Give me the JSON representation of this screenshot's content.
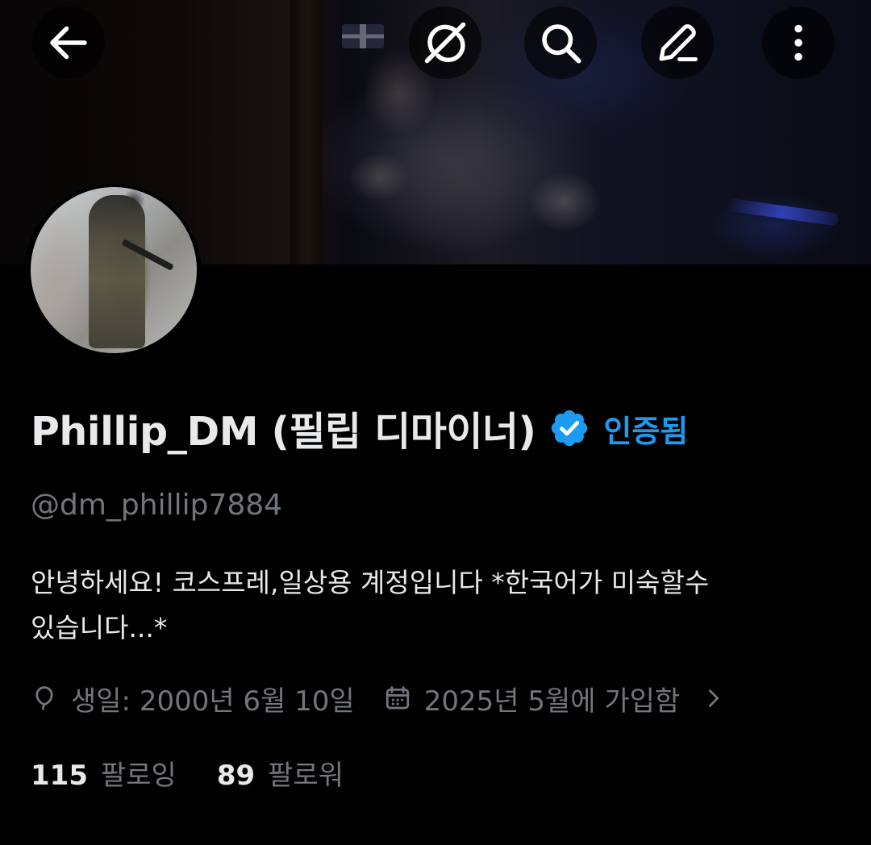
{
  "header": {
    "back_icon": "arrow-left-icon",
    "grok_icon": "grok-icon",
    "search_icon": "search-icon",
    "edit_icon": "edit-pencil-icon",
    "more_icon": "more-vertical-icon"
  },
  "profile": {
    "display_name": "Phillip_DM (필립 디마이너)",
    "verified_label": "인증됨",
    "handle": "@dm_phillip7884",
    "bio_line1": "안녕하세요! 코스프레,일상용 계정입니다  *한국어가 미숙할수",
    "bio_line2": "있습니다...*",
    "birthday": "생일: 2000년 6월 10일",
    "joined": "2025년 5월에 가입함",
    "following_count": "115",
    "following_label": "팔로잉",
    "followers_count": "89",
    "followers_label": "팔로워"
  },
  "colors": {
    "background": "#000000",
    "primary_text": "#e7e9ea",
    "secondary_text": "#71767b",
    "accent": "#1d9bf0"
  }
}
